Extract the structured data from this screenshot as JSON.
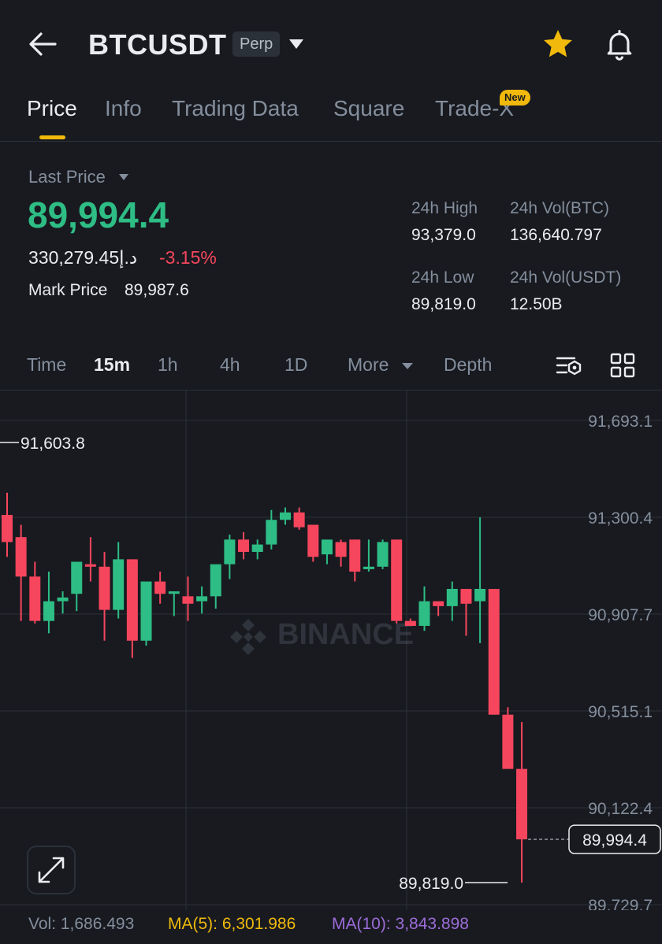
{
  "header": {
    "symbol": "BTCUSDT",
    "contract_badge": "Perp",
    "icons": [
      "back-arrow-icon",
      "chevron-down-icon",
      "star-icon",
      "bell-icon"
    ]
  },
  "tabs": [
    {
      "label": "Price",
      "active": true
    },
    {
      "label": "Info",
      "active": false
    },
    {
      "label": "Trading Data",
      "active": false
    },
    {
      "label": "Square",
      "active": false
    },
    {
      "label": "Trade-X",
      "active": false
    }
  ],
  "new_badge": "New",
  "price": {
    "last_price_label": "Last Price",
    "last_price": "89,994.4",
    "fiat_value": "330,279.45د.إ",
    "change_pct": "-3.15%",
    "mark_price_label": "Mark Price",
    "mark_price": "89,987.6"
  },
  "stats": {
    "high_label": "24h High",
    "high": "93,379.0",
    "vol_btc_label": "24h Vol(BTC)",
    "vol_btc": "136,640.797",
    "low_label": "24h Low",
    "low": "89,819.0",
    "vol_usdt_label": "24h Vol(USDT)",
    "vol_usdt": "12.50B"
  },
  "intervals": {
    "items": [
      "Time",
      "15m",
      "1h",
      "4h",
      "1D",
      "More",
      "Depth"
    ],
    "active": "15m",
    "icons": [
      "indicator-settings-icon",
      "layout-grid-icon"
    ]
  },
  "chart_data": {
    "type": "candlestick",
    "watermark": "BINANCE",
    "y_axis_labels": [
      "91,693.1",
      "91,300.4",
      "90,907.7",
      "90,515.1",
      "90,122.4",
      "89,729.7"
    ],
    "ylim": [
      89700,
      91700
    ],
    "high_marker": "91,603.8",
    "low_marker": "89,819.0",
    "current_price_label": "89,994.4",
    "current_price": 89994.4,
    "colors": {
      "up": "#2ebd85",
      "down": "#f6465d",
      "grid": "#2b3139",
      "axis_text": "#848e9c"
    },
    "candles": [
      {
        "o": 91310,
        "h": 91400,
        "l": 91140,
        "c": 91200
      },
      {
        "o": 91220,
        "h": 91270,
        "l": 90880,
        "c": 91060
      },
      {
        "o": 91060,
        "h": 91120,
        "l": 90870,
        "c": 90880
      },
      {
        "o": 90880,
        "h": 91080,
        "l": 90830,
        "c": 90960
      },
      {
        "o": 90960,
        "h": 91000,
        "l": 90910,
        "c": 90975
      },
      {
        "o": 90990,
        "h": 91120,
        "l": 90920,
        "c": 91120
      },
      {
        "o": 91110,
        "h": 91220,
        "l": 91040,
        "c": 91100
      },
      {
        "o": 91100,
        "h": 91160,
        "l": 90800,
        "c": 90925
      },
      {
        "o": 90925,
        "h": 91200,
        "l": 90890,
        "c": 91130
      },
      {
        "o": 91130,
        "h": 91130,
        "l": 90730,
        "c": 90800
      },
      {
        "o": 90800,
        "h": 91030,
        "l": 90780,
        "c": 91040
      },
      {
        "o": 91040,
        "h": 91080,
        "l": 90950,
        "c": 90990
      },
      {
        "o": 90990,
        "h": 91000,
        "l": 90900,
        "c": 91000
      },
      {
        "o": 90980,
        "h": 91060,
        "l": 90880,
        "c": 90950
      },
      {
        "o": 90960,
        "h": 91020,
        "l": 90910,
        "c": 90980
      },
      {
        "o": 90980,
        "h": 91080,
        "l": 90930,
        "c": 91110
      },
      {
        "o": 91110,
        "h": 91230,
        "l": 91050,
        "c": 91210
      },
      {
        "o": 91210,
        "h": 91240,
        "l": 91130,
        "c": 91160
      },
      {
        "o": 91160,
        "h": 91210,
        "l": 91130,
        "c": 91190
      },
      {
        "o": 91190,
        "h": 91330,
        "l": 91170,
        "c": 91290
      },
      {
        "o": 91290,
        "h": 91340,
        "l": 91270,
        "c": 91320
      },
      {
        "o": 91320,
        "h": 91340,
        "l": 91250,
        "c": 91260
      },
      {
        "o": 91270,
        "h": 91270,
        "l": 91120,
        "c": 91140
      },
      {
        "o": 91150,
        "h": 91200,
        "l": 91110,
        "c": 91210
      },
      {
        "o": 91200,
        "h": 91210,
        "l": 91100,
        "c": 91140
      },
      {
        "o": 91210,
        "h": 91210,
        "l": 91040,
        "c": 91080
      },
      {
        "o": 91090,
        "h": 91210,
        "l": 91080,
        "c": 91100
      },
      {
        "o": 91100,
        "h": 91210,
        "l": 91090,
        "c": 91200
      },
      {
        "o": 91210,
        "h": 91210,
        "l": 90870,
        "c": 90880
      },
      {
        "o": 90880,
        "h": 90890,
        "l": 90860,
        "c": 90860
      },
      {
        "o": 90860,
        "h": 91020,
        "l": 90840,
        "c": 90960
      },
      {
        "o": 90960,
        "h": 90950,
        "l": 90900,
        "c": 90940
      },
      {
        "o": 90940,
        "h": 91040,
        "l": 90880,
        "c": 91010
      },
      {
        "o": 91010,
        "h": 91000,
        "l": 90820,
        "c": 90950
      },
      {
        "o": 90960,
        "h": 91300,
        "l": 90790,
        "c": 91010
      },
      {
        "o": 91010,
        "h": 91010,
        "l": 90500,
        "c": 90500
      },
      {
        "o": 90500,
        "h": 90530,
        "l": 90340,
        "c": 90280
      },
      {
        "o": 90280,
        "h": 90470,
        "l": 89819,
        "c": 89994.4
      }
    ]
  },
  "volume": {
    "vol_label": "Vol: 1,686.493",
    "ma5_label": "MA(5): 6,301.986",
    "ma10_label": "MA(10): 3,843.898",
    "colors": {
      "vol": "#848e9c",
      "ma5": "#f0b90b",
      "ma10": "#9c6cd8"
    }
  }
}
